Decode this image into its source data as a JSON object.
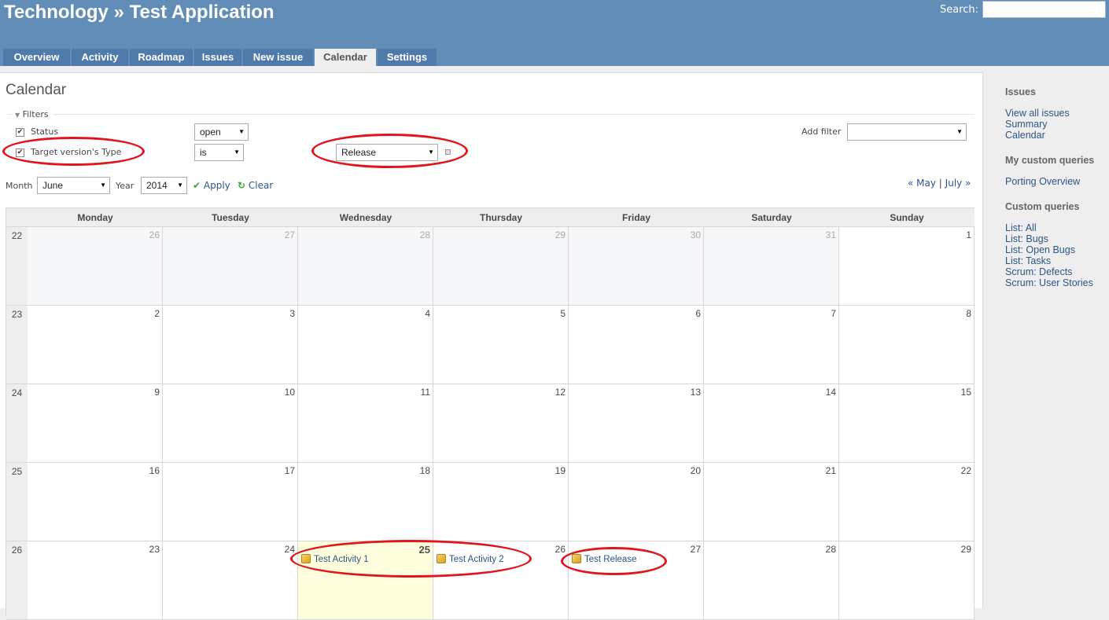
{
  "header": {
    "title": "Technology » Test Application",
    "search_label": "Search:"
  },
  "tabs": [
    "Overview",
    "Activity",
    "Roadmap",
    "Issues",
    "New issue",
    "Calendar",
    "Settings"
  ],
  "selected_tab": "Calendar",
  "page": {
    "title": "Calendar",
    "filters_legend": "Filters",
    "filters": {
      "status_label": "Status",
      "status_operator": "open",
      "type_label": "Target version's Type",
      "type_operator": "is",
      "type_value": "Release",
      "add_filter_label": "Add filter"
    },
    "month_label": "Month",
    "month_value": "June",
    "year_label": "Year",
    "year_value": "2014",
    "apply": "Apply",
    "clear": "Clear",
    "nav_prev": "« May",
    "nav_sep": "|",
    "nav_next": "July »"
  },
  "calendar": {
    "weekdays": [
      "Monday",
      "Tuesday",
      "Wednesday",
      "Thursday",
      "Friday",
      "Saturday",
      "Sunday"
    ],
    "weeks": [
      {
        "week": "22",
        "days": [
          "26",
          "27",
          "28",
          "29",
          "30",
          "31",
          "1"
        ]
      },
      {
        "week": "23",
        "days": [
          "2",
          "3",
          "4",
          "5",
          "6",
          "7",
          "8"
        ]
      },
      {
        "week": "24",
        "days": [
          "9",
          "10",
          "11",
          "12",
          "13",
          "14",
          "15"
        ]
      },
      {
        "week": "25",
        "days": [
          "16",
          "17",
          "18",
          "19",
          "20",
          "21",
          "22"
        ]
      },
      {
        "week": "26",
        "days": [
          "23",
          "24",
          "25",
          "26",
          "27",
          "28",
          "29"
        ]
      }
    ],
    "events": {
      "wed": "Test Activity 1",
      "thu": "Test Activity 2",
      "fri": "Test Release"
    }
  },
  "sidebar": {
    "issues_heading": "Issues",
    "issues_links": [
      "View all issues",
      "Summary",
      "Calendar"
    ],
    "my_queries_heading": "My custom queries",
    "my_queries": [
      "Porting Overview"
    ],
    "custom_heading": "Custom queries",
    "custom_queries": [
      "List: All",
      "List: Bugs",
      "List: Open Bugs",
      "List: Tasks",
      "Scrum: Defects",
      "Scrum: User Stories"
    ]
  },
  "colors": {
    "header": "#628db6",
    "tab": "#507aaa",
    "link": "#2a5685",
    "annotation": "#e0151d",
    "today": "#ffffdd"
  }
}
